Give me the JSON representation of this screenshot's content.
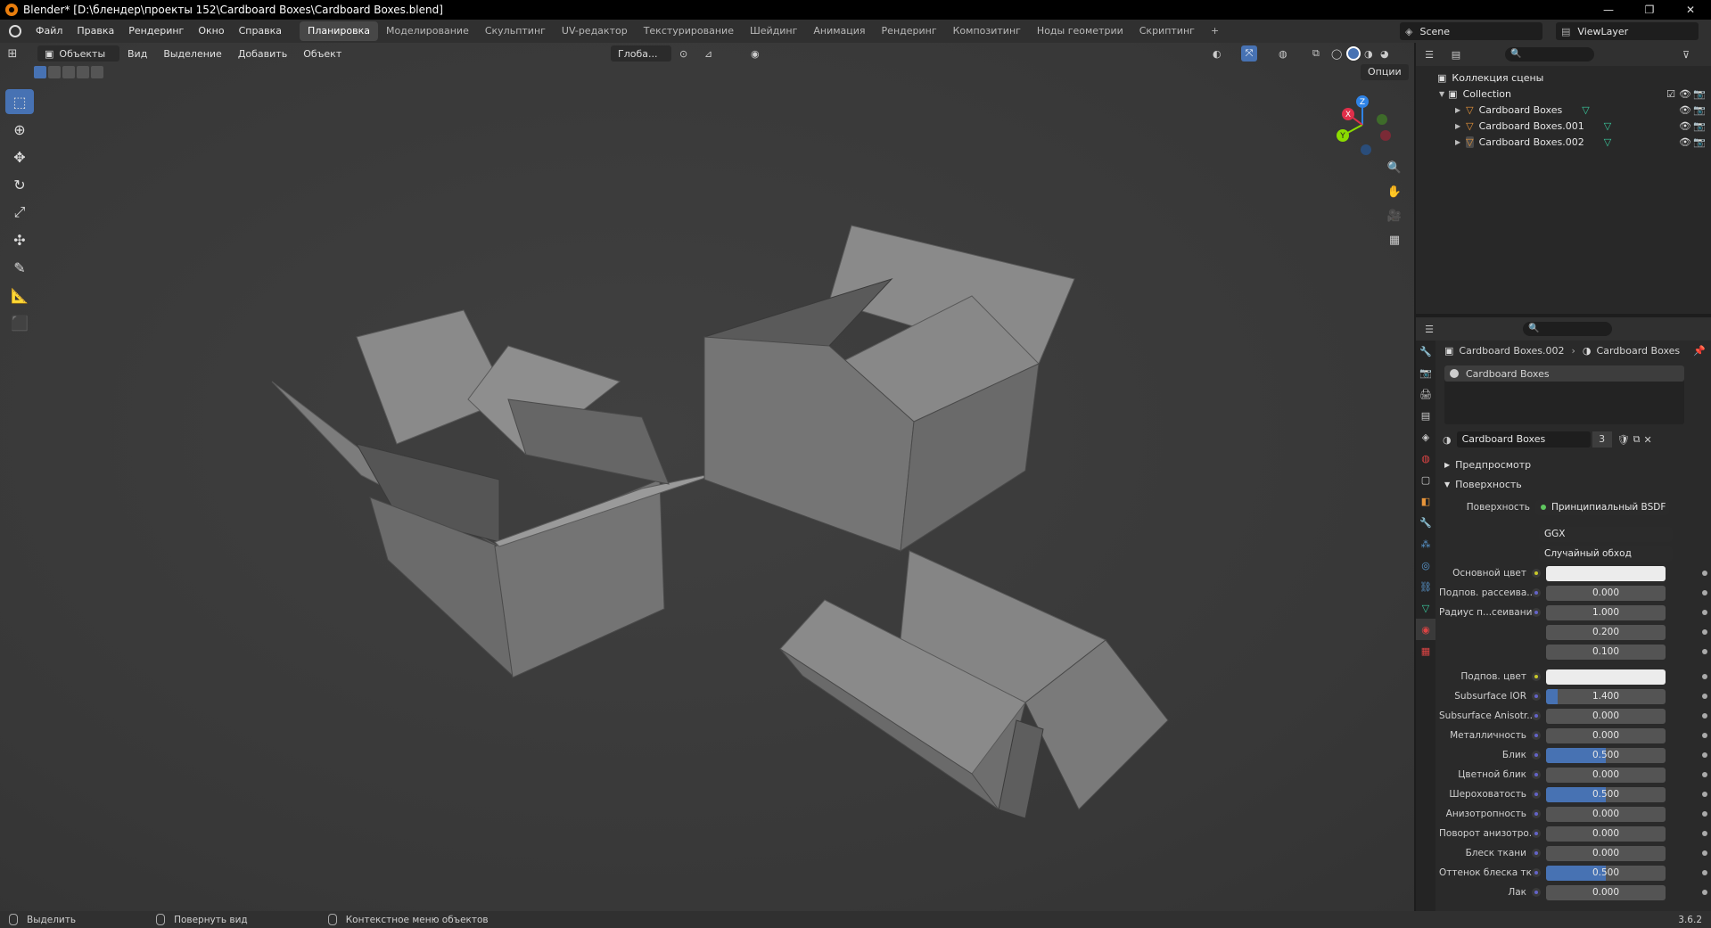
{
  "window": {
    "title": "Blender* [D:\\блендер\\проекты 152\\Cardboard Boxes\\Cardboard Boxes.blend]",
    "minimize": "—",
    "maximize": "❐",
    "close": "✕"
  },
  "topbar": {
    "menu": [
      "Файл",
      "Правка",
      "Рендеринг",
      "Окно",
      "Справка"
    ],
    "workspaces": [
      "Планировка",
      "Моделирование",
      "Скульптинг",
      "UV-редактор",
      "Текстурирование",
      "Шейдинг",
      "Анимация",
      "Рендеринг",
      "Композитинг",
      "Ноды геометрии",
      "Скриптинг",
      "+"
    ],
    "active_workspace": "Планировка",
    "scene": "Scene",
    "view_layer": "ViewLayer"
  },
  "viewport": {
    "mode": "Объекты",
    "menu": [
      "Вид",
      "Выделение",
      "Добавить",
      "Объект"
    ],
    "orientation": "Глоба...",
    "options": "Опции",
    "gizmo": {
      "x": "X",
      "y": "Y",
      "z": "Z"
    }
  },
  "tools": [
    "select-box",
    "cursor",
    "move",
    "rotate",
    "scale",
    "transform",
    "annotate",
    "measure",
    "add-cube"
  ],
  "outliner": {
    "root": "Коллекция сцены",
    "collection": "Collection",
    "objects": [
      "Cardboard Boxes",
      "Cardboard Boxes.001",
      "Cardboard Boxes.002"
    ]
  },
  "properties": {
    "breadcrumb_object": "Cardboard Boxes.002",
    "breadcrumb_material": "Cardboard Boxes",
    "slot": "Cardboard Boxes",
    "material_name": "Cardboard Boxes",
    "users": "3",
    "sections": {
      "preview": "Предпросмотр",
      "surface": "Поверхность"
    },
    "surface_label": "Поверхность",
    "surface_shader": "Принципиальный BSDF",
    "distribution": "GGX",
    "subsurface_method": "Случайный обход",
    "rows": [
      {
        "label": "Основной цвет",
        "type": "color",
        "value": "",
        "socket": "yellow"
      },
      {
        "label": "Подпов. рассеива...",
        "type": "num",
        "value": "0.000",
        "socket": "blue",
        "fill": 0
      },
      {
        "label": "Радиус п...сеивания",
        "type": "num",
        "value": "1.000",
        "socket": "blue",
        "fill": 0
      },
      {
        "label": "",
        "type": "num",
        "value": "0.200",
        "socket": "none",
        "fill": 0
      },
      {
        "label": "",
        "type": "num",
        "value": "0.100",
        "socket": "none",
        "fill": 0
      },
      {
        "label": "Подпов. цвет",
        "type": "color",
        "value": "",
        "socket": "yellow"
      },
      {
        "label": "Subsurface IOR",
        "type": "num",
        "value": "1.400",
        "socket": "blue",
        "fill": 0.1
      },
      {
        "label": "Subsurface Anisotr...",
        "type": "num",
        "value": "0.000",
        "socket": "blue",
        "fill": 0
      },
      {
        "label": "Металличность",
        "type": "num",
        "value": "0.000",
        "socket": "blue",
        "fill": 0
      },
      {
        "label": "Блик",
        "type": "num",
        "value": "0.500",
        "socket": "blue",
        "fill": 0.5
      },
      {
        "label": "Цветной блик",
        "type": "num",
        "value": "0.000",
        "socket": "blue",
        "fill": 0
      },
      {
        "label": "Шероховатость",
        "type": "num",
        "value": "0.500",
        "socket": "blue",
        "fill": 0.5
      },
      {
        "label": "Анизотропность",
        "type": "num",
        "value": "0.000",
        "socket": "blue",
        "fill": 0
      },
      {
        "label": "Поворот анизотро...",
        "type": "num",
        "value": "0.000",
        "socket": "blue",
        "fill": 0
      },
      {
        "label": "Блеск ткани",
        "type": "num",
        "value": "0.000",
        "socket": "blue",
        "fill": 0
      },
      {
        "label": "Оттенок блеска тк...",
        "type": "num",
        "value": "0.500",
        "socket": "blue",
        "fill": 0.5
      },
      {
        "label": "Лак",
        "type": "num",
        "value": "0.000",
        "socket": "blue",
        "fill": 0
      }
    ]
  },
  "statusbar": {
    "select": "Выделить",
    "rotate": "Повернуть вид",
    "context": "Контекстное меню объектов",
    "version": "3.6.2"
  },
  "colors": {
    "accent": "#4772b3",
    "viewport_bg": "#3c3c3c",
    "panel_bg": "#2a2a2a",
    "header_bg": "#303030"
  }
}
